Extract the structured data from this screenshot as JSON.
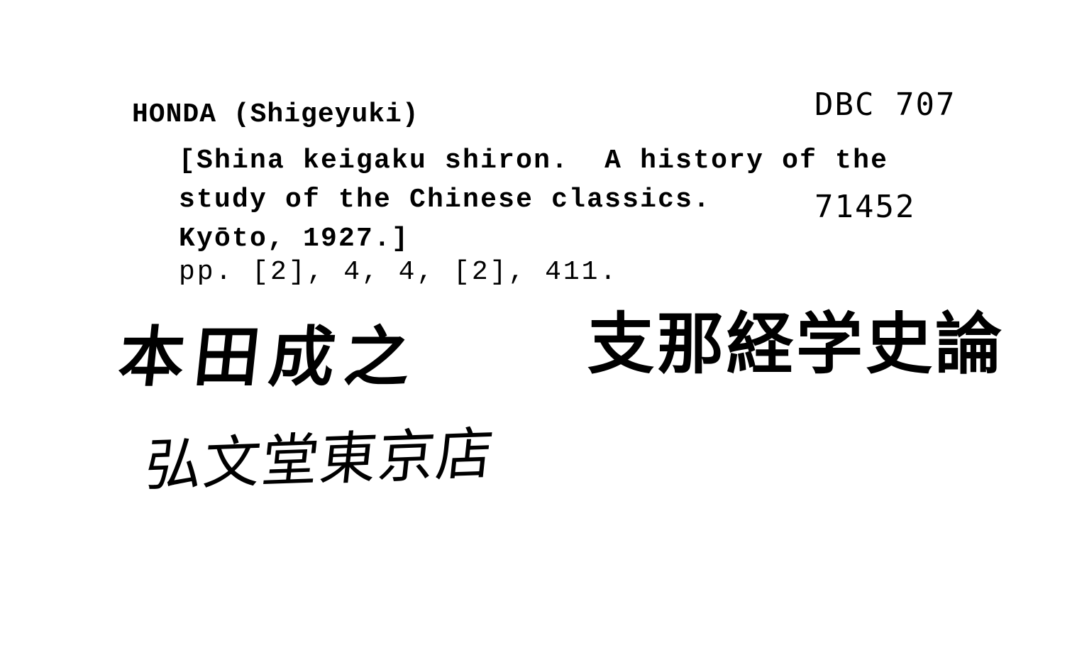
{
  "card": {
    "shelfmark": [
      "DBC 707",
      "71452"
    ],
    "heading": "HONDA (Shigeyuki)",
    "body_lines": [
      "[Shina keigaku shiron.  A history of the",
      "study of the Chinese classics.",
      "Kyōto, 1927.]",
      "pp. [2], 4, 4, [2], 411."
    ],
    "handwritten": {
      "author": "本田成之",
      "title": "支那経学史論",
      "publisher": "弘文堂東京店"
    }
  }
}
